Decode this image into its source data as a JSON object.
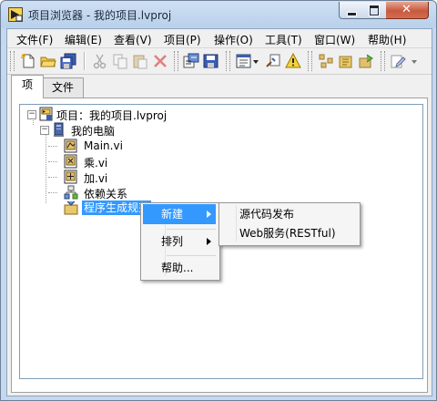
{
  "window": {
    "title": "项目浏览器 - 我的项目.lvproj"
  },
  "menu": [
    "文件(F)",
    "编辑(E)",
    "查看(V)",
    "项目(P)",
    "操作(O)",
    "工具(T)",
    "窗口(W)",
    "帮助(H)"
  ],
  "toolbar": {
    "icons": [
      "new-file-icon",
      "open-folder-icon",
      "save-all-icon",
      "cut-icon",
      "copy-icon",
      "paste-icon",
      "delete-icon",
      "build-icon",
      "save-project-icon",
      "view-options-icon",
      "dropdown-arrow-icon",
      "find-icon",
      "warning-icon",
      "dependencies-icon",
      "build-spec-icon",
      "deploy-icon",
      "edit-icon"
    ]
  },
  "tabs": [
    "项",
    "文件"
  ],
  "tree": {
    "root": "项目：我的项目.lvproj",
    "computer": "我的电脑",
    "files": [
      "Main.vi",
      "乘.vi",
      "加.vi"
    ],
    "dependencies": "依赖关系",
    "build_specs": "程序生成规范"
  },
  "context_menu": {
    "items": [
      "新建",
      "排列",
      "帮助..."
    ]
  },
  "submenu": {
    "items": [
      "源代码发布",
      "Web服务(RESTful)"
    ]
  },
  "colors": {
    "selection": "#3399ff",
    "title_bar": "#b9d1ea",
    "close_button": "#c75a3e"
  }
}
